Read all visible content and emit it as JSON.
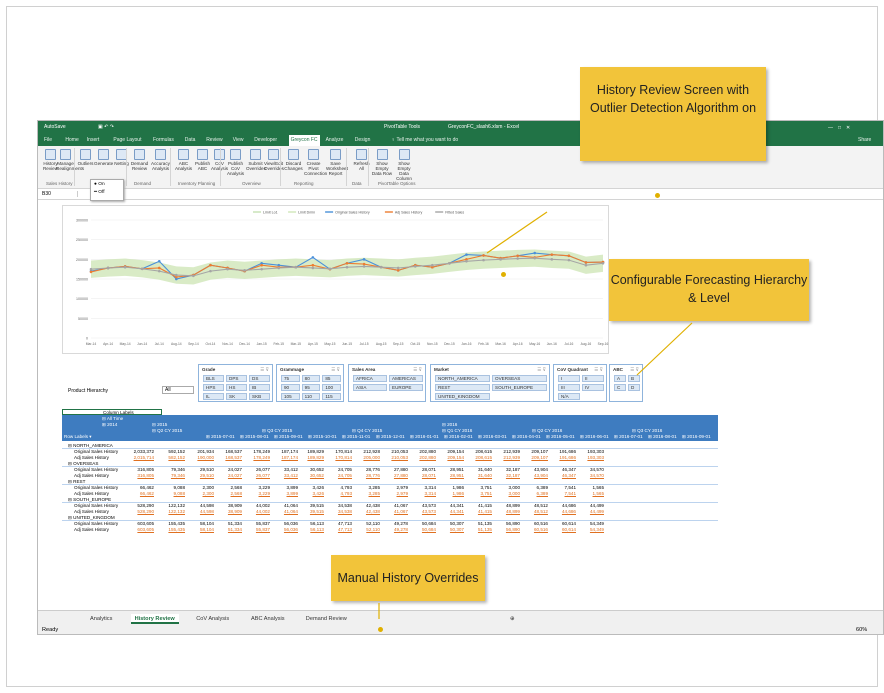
{
  "window": {
    "title": "GreyconFC_slash6.xlsm - Excel",
    "context_tab": "PivotTable Tools",
    "quick_access": "AutoSave",
    "user": "Share"
  },
  "ribbon_tabs": [
    "File",
    "Home",
    "Insert",
    "Page Layout",
    "Formulas",
    "Data",
    "Review",
    "View",
    "Developer",
    "Greycon FC",
    "Analyze",
    "Design"
  ],
  "active_tab": "Greycon FC",
  "tell_me": "Tell me what you want to do",
  "ribbon": {
    "buttons": [
      "History Review",
      "Manage Realignments",
      "Outliers",
      "Generate",
      "Netting",
      "Demand Review",
      "Accuracy Analysis",
      "ABC Analysis",
      "Publish ABC",
      "CoV Analysis",
      "Publish CoV Analysis",
      "Submit Overrides",
      "View/Edit Overrides",
      "Discard Changes",
      "Create Pivot Connection",
      "Save Worksheet Report",
      "Refresh All",
      "Show Empty Data Row",
      "Show Empty Data Column"
    ],
    "groups": [
      "Sales History",
      "Forecast",
      "Demand",
      "Inventory Planning",
      "Overview",
      "Reporting",
      "Data",
      "PivotTable Options"
    ],
    "outliers_menu": [
      "On",
      "Off"
    ]
  },
  "formula_bar": {
    "cell": "B30",
    "fx": "fx"
  },
  "chart_data": {
    "type": "line",
    "legend": [
      "Limit Lo1",
      "Limit Dmin",
      "Original Sales History",
      "Adj Sales History",
      "Fitted Sales"
    ],
    "y_ticks": [
      "300000",
      "250000",
      "200000",
      "150000",
      "100000",
      "50000",
      "0"
    ],
    "ylim": [
      0,
      300000
    ],
    "x": [
      "Mar-14",
      "Apr-14",
      "May-14",
      "Jun-14",
      "Jul-14",
      "Aug-14",
      "Sep-14",
      "Oct-14",
      "Nov-14",
      "Dec-14",
      "Jan-15",
      "Feb-15",
      "Mar-15",
      "Apr-15",
      "May-15",
      "Jun-15",
      "Jul-15",
      "Aug-15",
      "Sep-15",
      "Oct-15",
      "Nov-15",
      "Dec-15",
      "Jan-16",
      "Feb-16",
      "Mar-16",
      "Apr-16",
      "May-16",
      "Jun-16",
      "Jul-16",
      "Aug-16",
      "Sep-16"
    ],
    "series": [
      {
        "name": "Original Sales History",
        "color": "#4a90d9",
        "values": [
          170000,
          178000,
          182000,
          176000,
          195000,
          150000,
          160000,
          185000,
          178000,
          170000,
          190000,
          185000,
          180000,
          205000,
          175000,
          190000,
          200000,
          180000,
          172000,
          185000,
          180000,
          190000,
          212000,
          210000,
          203000,
          209000,
          216000,
          212000,
          209000,
          192000,
          193000
        ]
      },
      {
        "name": "Adj Sales History",
        "color": "#ed7d31",
        "values": [
          168000,
          178000,
          182000,
          176000,
          178000,
          155000,
          160000,
          185000,
          178000,
          170000,
          185000,
          180000,
          180000,
          185000,
          175000,
          190000,
          188000,
          180000,
          172000,
          185000,
          180000,
          190000,
          200000,
          210000,
          203000,
          209000,
          205000,
          212000,
          209000,
          192000,
          193000
        ]
      },
      {
        "name": "Fitted Sales",
        "color": "#a5a5a5",
        "values": [
          175000,
          178000,
          180000,
          176000,
          170000,
          160000,
          158000,
          170000,
          175000,
          172000,
          175000,
          178000,
          180000,
          178000,
          176000,
          180000,
          182000,
          180000,
          178000,
          182000,
          185000,
          190000,
          195000,
          198000,
          200000,
          202000,
          203000,
          200000,
          198000,
          185000,
          190000
        ]
      }
    ]
  },
  "slicers": [
    {
      "title": "Grade",
      "items": [
        "BLS",
        "DPS",
        "DS",
        "HPS",
        "HS",
        "IB",
        "IL",
        "SK",
        "SKB"
      ]
    },
    {
      "title": "Grammage",
      "items": [
        "75",
        "80",
        "85",
        "90",
        "95",
        "100",
        "105",
        "110",
        "115"
      ]
    },
    {
      "title": "Sales Area",
      "items": [
        "AFRICA",
        "AMERICAS",
        "ASIA",
        "EUROPE"
      ]
    },
    {
      "title": "Market",
      "items": [
        "NORTH_AMERICA",
        "OVERSEAS",
        "REST",
        "SOUTH_EUROPE",
        "UNITED_KINGDOM"
      ]
    },
    {
      "title": "CoV Quadrant",
      "items": [
        "I",
        "II",
        "III",
        "IV",
        "N/A"
      ]
    },
    {
      "title": "ABC",
      "items": [
        "A",
        "B",
        "C",
        "D"
      ]
    }
  ],
  "product_hierarchy": {
    "label": "Product Hierarchy",
    "value": "All"
  },
  "pivot": {
    "column_labels": "Column Labels",
    "all_time": "All Time",
    "row_labels": "Row Labels",
    "year_labels": [
      "2014",
      "2015",
      "2016"
    ],
    "quarter_labels": [
      "Q2 CY 2015",
      "Q3 CY 2015",
      "Q4 CY 2015",
      "Q1 CY 2016",
      "Q2 CY 2016",
      "Q3 CY 2016"
    ],
    "month_labels": [
      "2015-07-01",
      "2015-08-01",
      "2015-09-01",
      "2015-10-01",
      "2015-11-01",
      "2015-12-01",
      "2016-01-01",
      "2016-02-01",
      "2016-03-01",
      "2016-04-01",
      "2016-05-01",
      "2016-06-01",
      "2016-07-01",
      "2016-08-01",
      "2016-09-01"
    ],
    "groups": [
      {
        "name": "NORTH_AMERICA",
        "orig": [
          "2,033,372",
          "592,152",
          "201,934",
          "168,537",
          "178,249",
          "187,174",
          "189,829",
          "170,814",
          "212,928",
          "210,053",
          "202,880",
          "209,154",
          "208,615",
          "212,939",
          "209,107",
          "191,686",
          "193,303"
        ],
        "adj": [
          "2,015,714",
          "582,152",
          "190,000",
          "168,537",
          "178,249",
          "187,174",
          "189,829",
          "170,814",
          "205,000",
          "210,053",
          "202,880",
          "209,154",
          "208,615",
          "212,939",
          "209,107",
          "191,686",
          "193,303"
        ]
      },
      {
        "name": "OVERSEAS",
        "orig": [
          "316,805",
          "79,346",
          "29,510",
          "24,027",
          "26,077",
          "33,412",
          "30,652",
          "24,705",
          "28,776",
          "27,880",
          "28,071",
          "28,951",
          "31,640",
          "32,187",
          "43,904",
          "46,347",
          "34,570"
        ],
        "adj": [
          "316,805",
          "79,346",
          "29,510",
          "24,027",
          "26,077",
          "33,412",
          "30,652",
          "24,705",
          "28,776",
          "27,880",
          "28,071",
          "28,951",
          "31,640",
          "32,187",
          "43,904",
          "46,347",
          "34,570"
        ]
      },
      {
        "name": "REST",
        "orig": [
          "66,462",
          "9,088",
          "2,300",
          "2,568",
          "3,229",
          "3,899",
          "3,426",
          "4,793",
          "3,285",
          "2,979",
          "3,314",
          "1,986",
          "3,751",
          "3,000",
          "6,389",
          "7,541",
          "1,565"
        ],
        "adj": [
          "66,462",
          "9,088",
          "2,300",
          "2,568",
          "3,229",
          "3,899",
          "3,426",
          "4,793",
          "3,285",
          "2,979",
          "3,314",
          "1,986",
          "3,751",
          "3,000",
          "6,389",
          "7,541",
          "1,565"
        ]
      },
      {
        "name": "SOUTH_EUROPE",
        "orig": [
          "528,290",
          "122,132",
          "44,598",
          "38,909",
          "44,002",
          "41,064",
          "39,515",
          "34,538",
          "42,438",
          "41,067",
          "43,573",
          "44,341",
          "41,415",
          "48,899",
          "48,512",
          "44,686",
          "44,499"
        ],
        "adj": [
          "528,290",
          "122,132",
          "44,598",
          "38,909",
          "44,002",
          "41,064",
          "39,515",
          "34,538",
          "42,438",
          "41,067",
          "43,573",
          "44,341",
          "41,415",
          "48,899",
          "48,512",
          "44,686",
          "44,499"
        ]
      },
      {
        "name": "UNITED_KINGDOM",
        "orig": [
          "603,605",
          "155,435",
          "58,104",
          "51,334",
          "55,837",
          "56,036",
          "56,113",
          "47,713",
          "52,110",
          "49,278",
          "50,684",
          "50,307",
          "51,135",
          "56,890",
          "60,516",
          "60,614",
          "54,349"
        ],
        "adj": [
          "603,605",
          "155,435",
          "58,104",
          "51,334",
          "55,837",
          "56,036",
          "56,113",
          "47,713",
          "52,110",
          "49,278",
          "50,684",
          "50,307",
          "51,135",
          "56,890",
          "60,516",
          "60,614",
          "54,349"
        ]
      }
    ],
    "row_orig": "Original Sales History",
    "row_adj": "Adj Sales History"
  },
  "sheet_tabs": [
    "Analytics",
    "History Review",
    "CoV Analysis",
    "ABC Analysis",
    "Demand Review"
  ],
  "active_sheet": "History Review",
  "status": {
    "ready": "Ready",
    "zoom": "60%"
  },
  "callouts": {
    "history": "History Review Screen with Outlier Detection Algorithm on",
    "hierarchy": "Configurable Forecasting Hierarchy & Level",
    "manual": "Manual History Overrides"
  }
}
